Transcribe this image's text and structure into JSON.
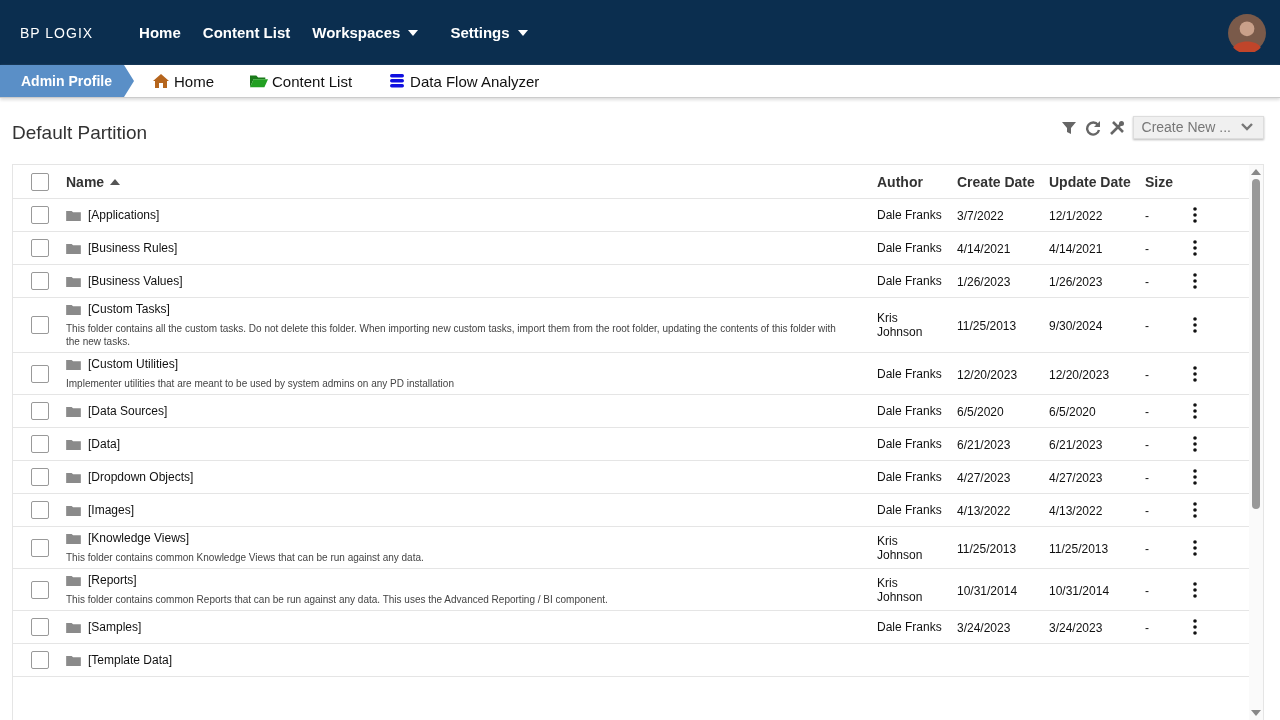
{
  "brand": "BP LOGIX",
  "nav": [
    {
      "label": "Home",
      "dropdown": false
    },
    {
      "label": "Content List",
      "dropdown": false
    },
    {
      "label": "Workspaces",
      "dropdown": true
    },
    {
      "label": "Settings",
      "dropdown": true
    }
  ],
  "breadcrumb": {
    "current": "Admin Profile",
    "links": [
      {
        "label": "Home",
        "kind": "home"
      },
      {
        "label": "Content List",
        "kind": "folder"
      },
      {
        "label": "Data Flow Analyzer",
        "kind": "db"
      }
    ]
  },
  "page_title": "Default Partition",
  "create_button": "Create New ...",
  "table": {
    "select_all_checked": false,
    "columns": [
      "Name",
      "Author",
      "Create Date",
      "Update Date",
      "Size"
    ],
    "rows": [
      {
        "name": "[Applications]",
        "author": "Dale Franks",
        "created": "3/7/2022",
        "updated": "12/1/2022",
        "size": "-",
        "checked": false
      },
      {
        "name": "[Business Rules]",
        "author": "Dale Franks",
        "created": "4/14/2021",
        "updated": "4/14/2021",
        "size": "-",
        "checked": false
      },
      {
        "name": "[Business Values]",
        "author": "Dale Franks",
        "created": "1/26/2023",
        "updated": "1/26/2023",
        "size": "-",
        "checked": false
      },
      {
        "name": "[Custom Tasks]",
        "description": "This folder contains all the custom tasks. Do not delete this folder. When importing new custom tasks, import them from the root folder, updating the contents of this folder with the new tasks.",
        "author": "Kris Johnson",
        "created": "11/25/2013",
        "updated": "9/30/2024",
        "size": "-",
        "checked": false
      },
      {
        "name": "[Custom Utilities]",
        "description": "Implementer utilities that are meant to be used by system admins on any PD installation",
        "author": "Dale Franks",
        "created": "12/20/2023",
        "updated": "12/20/2023",
        "size": "-",
        "checked": false
      },
      {
        "name": "[Data Sources]",
        "author": "Dale Franks",
        "created": "6/5/2020",
        "updated": "6/5/2020",
        "size": "-",
        "checked": false
      },
      {
        "name": "[Data]",
        "author": "Dale Franks",
        "created": "6/21/2023",
        "updated": "6/21/2023",
        "size": "-",
        "checked": false
      },
      {
        "name": "[Dropdown Objects]",
        "author": "Dale Franks",
        "created": "4/27/2023",
        "updated": "4/27/2023",
        "size": "-",
        "checked": false
      },
      {
        "name": "[Images]",
        "author": "Dale Franks",
        "created": "4/13/2022",
        "updated": "4/13/2022",
        "size": "-",
        "checked": false
      },
      {
        "name": "[Knowledge Views]",
        "description": "This folder contains common Knowledge Views that can be run against any data.",
        "author": "Kris Johnson",
        "created": "11/25/2013",
        "updated": "11/25/2013",
        "size": "-",
        "checked": false
      },
      {
        "name": "[Reports]",
        "description": "This folder contains common Reports that can be run against any data. This uses the Advanced Reporting / BI component.",
        "author": "Kris Johnson",
        "created": "10/31/2014",
        "updated": "10/31/2014",
        "size": "-",
        "checked": false
      },
      {
        "name": "[Samples]",
        "author": "Dale Franks",
        "created": "3/24/2023",
        "updated": "3/24/2023",
        "size": "-",
        "checked": false
      },
      {
        "name": "[Template Data]",
        "checked": false
      }
    ]
  }
}
